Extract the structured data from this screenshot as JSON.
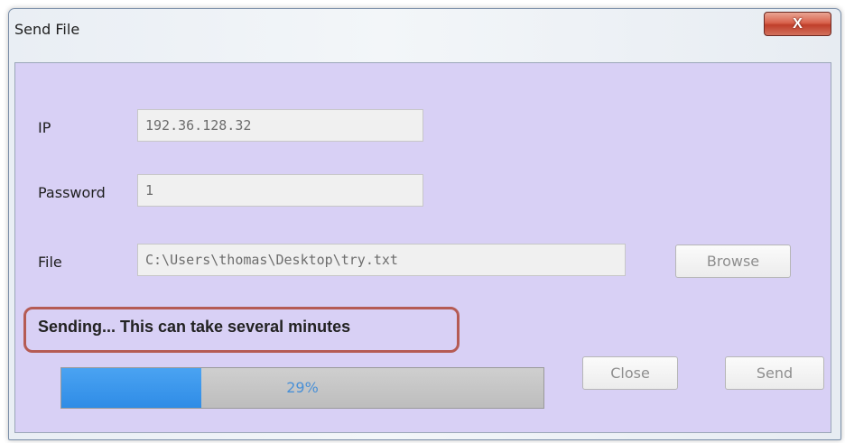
{
  "window": {
    "title": "Send File",
    "close_glyph": "X"
  },
  "form": {
    "ip_label": "IP",
    "ip_value": "192.36.128.32",
    "password_label": "Password",
    "password_value": "1",
    "file_label": "File",
    "file_value": "C:\\Users\\thomas\\Desktop\\try.txt"
  },
  "buttons": {
    "browse": "Browse",
    "close": "Close",
    "send": "Send"
  },
  "status": {
    "message": "Sending... This can take several minutes"
  },
  "progress": {
    "fraction": 0.29,
    "label": "29%"
  },
  "colors": {
    "client_background": "#d8d0f5",
    "progress_fill": "#2f8ce6",
    "highlight_border": "#b55b54",
    "close_button": "#d9634e"
  }
}
